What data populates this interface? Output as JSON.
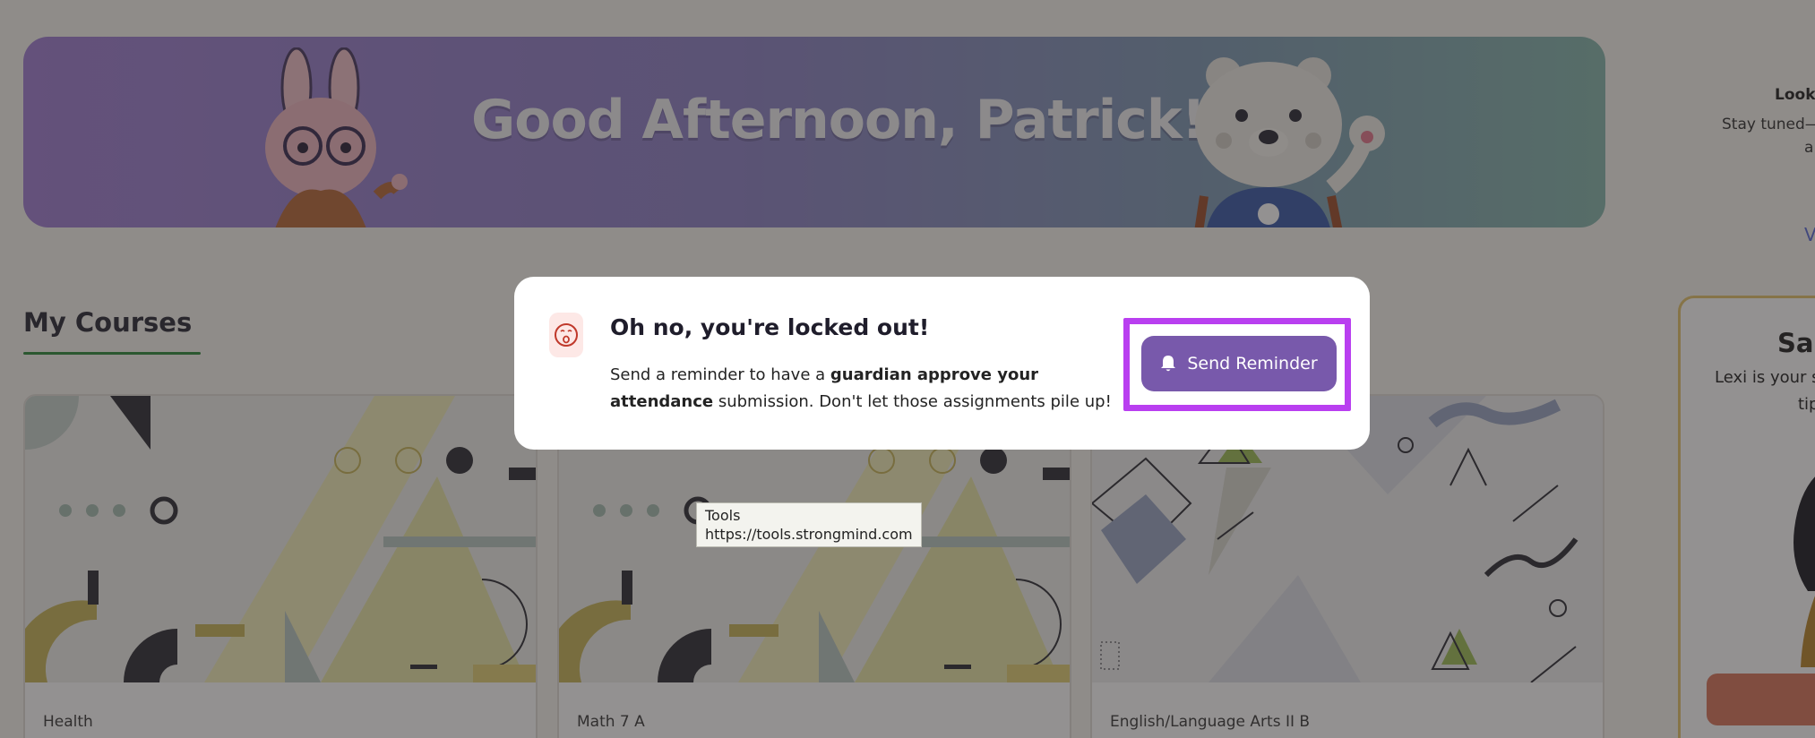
{
  "banner": {
    "greeting": "Good Afternoon, Patrick!"
  },
  "courses": {
    "heading": "My Courses",
    "items": [
      {
        "label": "Health"
      },
      {
        "label": "Math 7 A"
      },
      {
        "label": "English/Language Arts II B"
      }
    ]
  },
  "right_panel": {
    "looks_text": "Looks",
    "stay_text": "Stay tuned—",
    "line3": "a",
    "link_fragment": "V",
    "save_title": "Sa",
    "save_line1": "Lexi is your s",
    "save_line2": "tip"
  },
  "modal": {
    "title": "Oh no, you're locked out!",
    "body_pre": "Send a reminder to have a ",
    "body_bold": "guardian approve your attendance",
    "body_post": " submission. Don't let those assignments pile up!",
    "button_label": "Send Reminder",
    "icon": "surprised-face-icon",
    "button_icon": "bell-icon"
  },
  "tooltip": {
    "title": "Tools",
    "url": "https://tools.strongmind.com"
  },
  "colors": {
    "button": "#7859ab",
    "focus": "#b93ff0",
    "underline": "#2f8a3d"
  }
}
